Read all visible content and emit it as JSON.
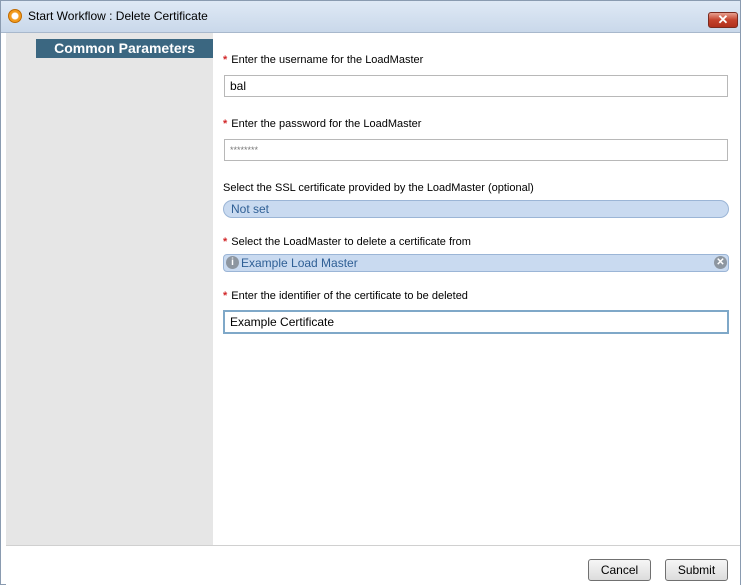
{
  "window": {
    "title": "Start Workflow : Delete Certificate",
    "close_label": "✕"
  },
  "sidebar": {
    "section_label": "Common Parameters"
  },
  "form": {
    "username": {
      "label": "Enter the username for the LoadMaster",
      "value": "bal",
      "required": true
    },
    "password": {
      "label": "Enter the password for the LoadMaster",
      "value": "********",
      "required": true
    },
    "ssl_certificate": {
      "label": "Select the SSL certificate provided by the LoadMaster (optional)",
      "value": "Not set",
      "required": false
    },
    "loadmaster": {
      "label": "Select the LoadMaster to delete a certificate from",
      "value": "Example Load Master",
      "required": true
    },
    "certificate_identifier": {
      "label": "Enter the identifier of the certificate to be deleted",
      "value": "Example Certificate",
      "required": true
    },
    "required_marker": "*"
  },
  "footer": {
    "cancel_label": "Cancel",
    "submit_label": "Submit"
  },
  "colors": {
    "section_tab_bg": "#3b6781",
    "pill_bg": "#c9daf0",
    "pill_text": "#2f5f95",
    "required_marker": "#d2282a",
    "close_button": "#c4422c"
  }
}
